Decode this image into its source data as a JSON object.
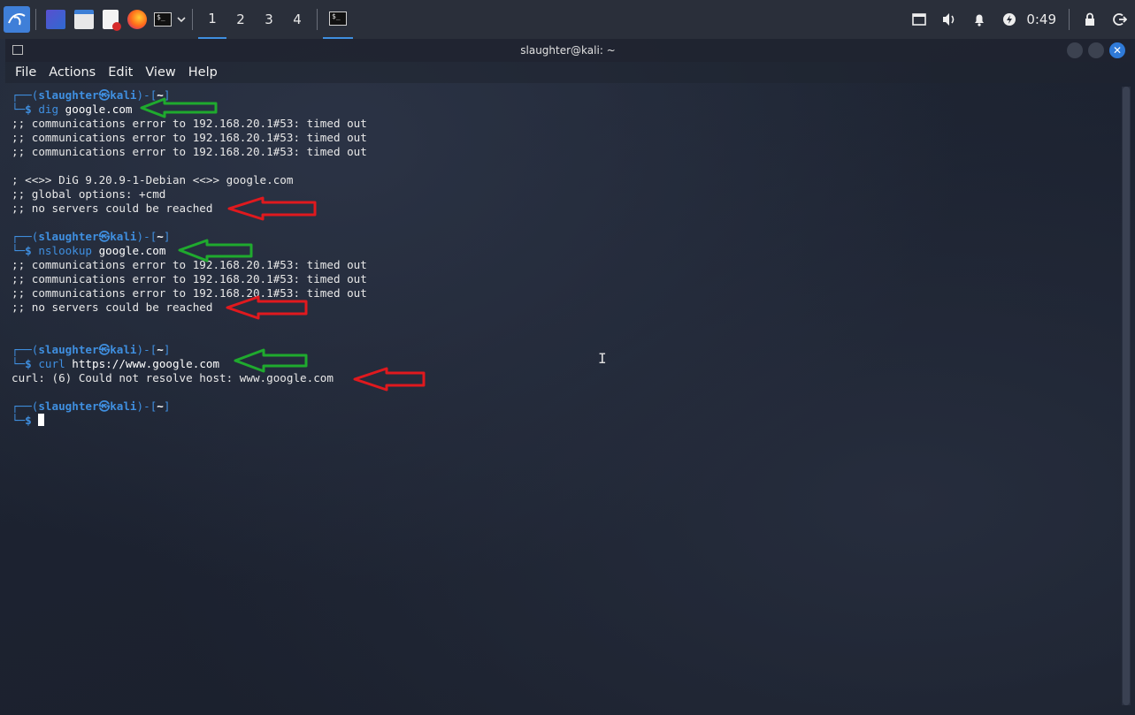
{
  "panel": {
    "workspaces": [
      "1",
      "2",
      "3",
      "4"
    ],
    "clock": "0:49",
    "icons": [
      "kali-menu-icon",
      "desktop-icon",
      "file-manager-icon",
      "text-editor-icon",
      "firefox-icon",
      "terminal-icon",
      "dropdown-chevron-icon",
      "display-icon",
      "volume-icon",
      "notification-bell-icon",
      "power-manager-icon",
      "lock-icon",
      "logout-icon"
    ]
  },
  "window": {
    "title": "slaughter@kali: ~",
    "menu": [
      "File",
      "Actions",
      "Edit",
      "View",
      "Help"
    ]
  },
  "terminal": {
    "prompt_user": "slaughter",
    "prompt_host": "kali",
    "prompt_dir": "~",
    "blocks": [
      {
        "cmd": "dig",
        "args": " google.com",
        "output": [
          ";; communications error to 192.168.20.1#53: timed out",
          ";; communications error to 192.168.20.1#53: timed out",
          ";; communications error to 192.168.20.1#53: timed out",
          "",
          "; <<>> DiG 9.20.9-1-Debian <<>> google.com",
          ";; global options: +cmd",
          ";; no servers could be reached",
          ""
        ]
      },
      {
        "cmd": "nslookup",
        "args": " google.com",
        "output": [
          ";; communications error to 192.168.20.1#53: timed out",
          ";; communications error to 192.168.20.1#53: timed out",
          ";; communications error to 192.168.20.1#53: timed out",
          ";; no servers could be reached",
          "",
          ""
        ]
      },
      {
        "cmd": "curl",
        "args": " https://www.google.com",
        "output": [
          "curl: (6) Could not resolve host: www.google.com",
          ""
        ]
      }
    ]
  },
  "colors": {
    "prompt_blue": "#3f8fe0",
    "arrow_green": "#1faa2e",
    "arrow_red": "#e0191e"
  }
}
